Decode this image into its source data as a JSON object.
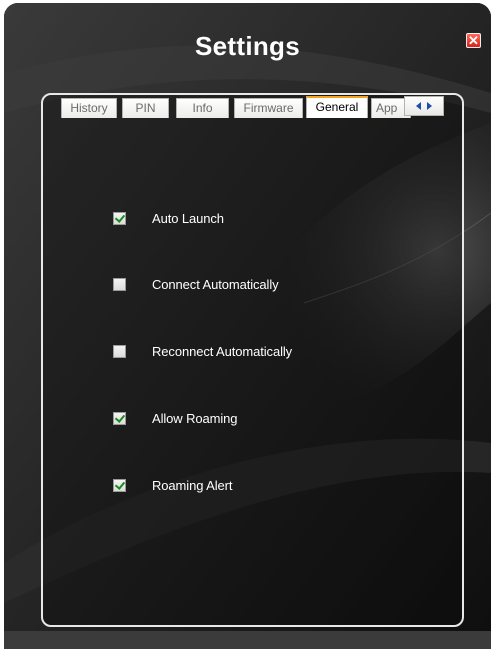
{
  "window": {
    "title": "Settings",
    "close_icon": "close-icon"
  },
  "tabs": [
    {
      "label": "History",
      "active": false
    },
    {
      "label": "PIN",
      "active": false
    },
    {
      "label": "Info",
      "active": false
    },
    {
      "label": "Firmware",
      "active": false
    },
    {
      "label": "General",
      "active": true
    },
    {
      "label": "App",
      "active": false
    }
  ],
  "tab_scroll": {
    "left_icon": "arrow-left-icon",
    "right_icon": "arrow-right-icon"
  },
  "options": [
    {
      "label": "Auto Launch",
      "checked": true
    },
    {
      "label": "Connect Automatically",
      "checked": false
    },
    {
      "label": "Reconnect Automatically",
      "checked": false
    },
    {
      "label": "Allow Roaming",
      "checked": true
    },
    {
      "label": "Roaming Alert",
      "checked": true
    }
  ],
  "colors": {
    "accent_tab": "#f7a21b",
    "background": "#141414",
    "check": "#1b8a1b"
  }
}
